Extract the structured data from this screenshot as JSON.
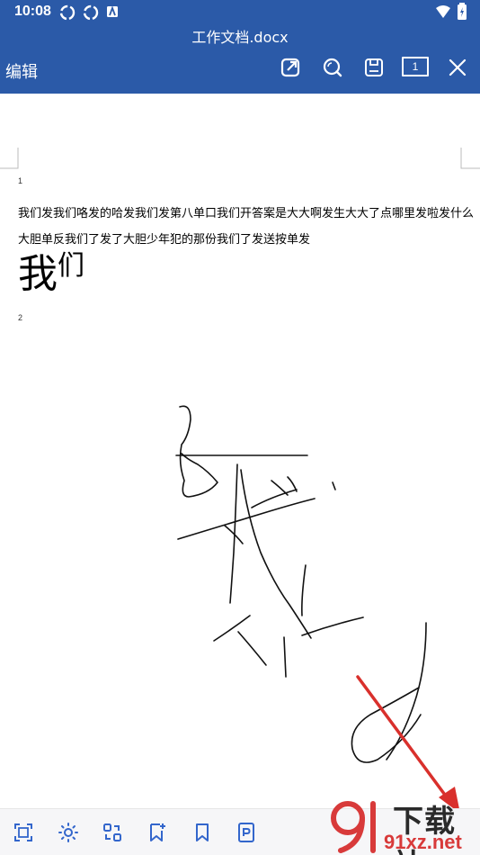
{
  "status_bar": {
    "time": "10:08"
  },
  "header": {
    "title": "工作文档.docx",
    "edit_label": "编辑",
    "page_indicator": "1",
    "toolbar_icons": [
      "share-icon",
      "search-icon",
      "save-icon",
      "page-indicator",
      "close-icon"
    ]
  },
  "document": {
    "page1_number": "1",
    "line1": "我们发我们咯发的哈发我们发第八单口我们开答案是大大啊发生大大了点哪里发啦发什么",
    "line2": "大胆单反我们了发了大胆少年犯的那份我们了发送按单发",
    "big_text_1": "我",
    "big_text_2": "们",
    "page2_number": "2"
  },
  "bottom_toolbar": {
    "icons": [
      "fit-screen-icon",
      "brightness-icon",
      "switch-view-icon",
      "bookmark-add-icon",
      "bookmark-icon",
      "pdf-icon"
    ]
  },
  "watermark": {
    "text_top": "下载站",
    "text_bottom": "91xz.net"
  },
  "colors": {
    "header_bg": "#2b5aa8",
    "icon_blue": "#3366cc",
    "arrow_red": "#d9302c"
  }
}
